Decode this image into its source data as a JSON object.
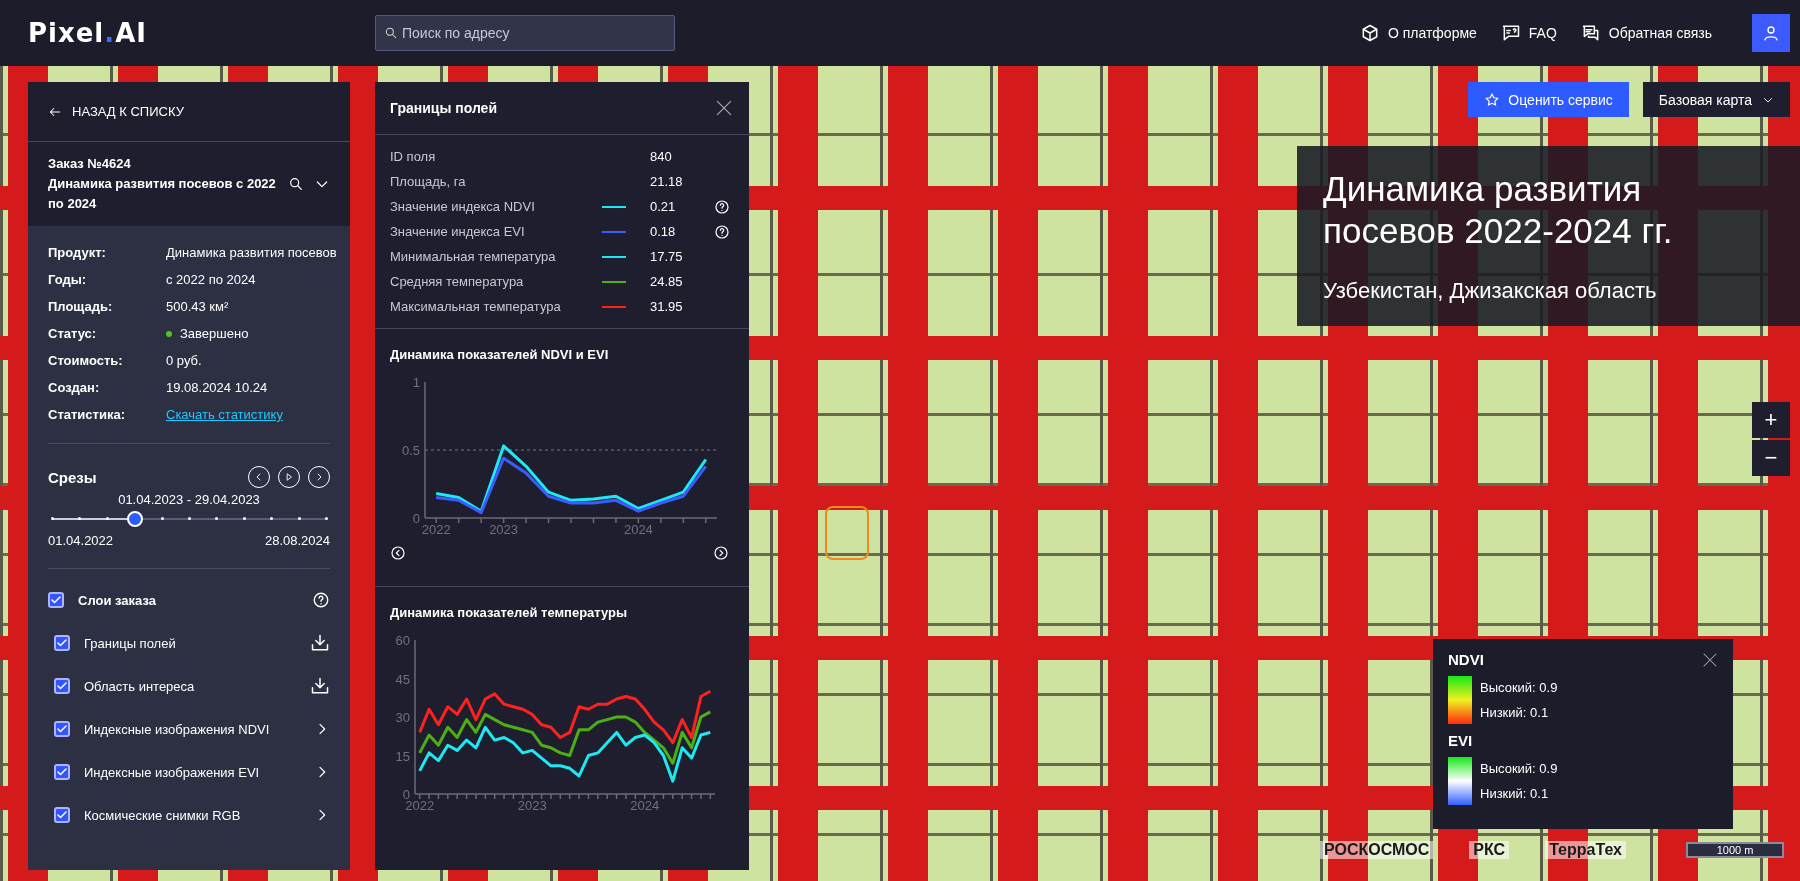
{
  "topbar": {
    "logo": {
      "main": "Pixel",
      "dot": ".",
      "suffix": "AI"
    },
    "search": {
      "placeholder": "Поиск по адресу"
    },
    "nav": [
      {
        "label": "О платформе"
      },
      {
        "label": "FAQ"
      },
      {
        "label": "Обратная связь"
      }
    ]
  },
  "order_panel": {
    "back": "НАЗАД К СПИСКУ",
    "order_number": "Заказ №4624",
    "order_title": "Динамика развития посевов с 2022 по 2024",
    "details": [
      {
        "label": "Продукт:",
        "value": "Динамика развития посевов",
        "kind": "text"
      },
      {
        "label": "Годы:",
        "value": "с 2022 по 2024",
        "kind": "text"
      },
      {
        "label": "Площадь:",
        "value": "500.43 км²",
        "kind": "text"
      },
      {
        "label": "Статус:",
        "value": "Завершено",
        "kind": "status",
        "color": "#52c41a"
      },
      {
        "label": "Стоимость:",
        "value": "0 руб.",
        "kind": "text"
      },
      {
        "label": "Создан:",
        "value": "19.08.2024 10.24",
        "kind": "text"
      },
      {
        "label": "Статистика:",
        "value": "Скачать статистику",
        "kind": "link"
      }
    ],
    "slices": {
      "title": "Срезы",
      "range": "01.04.2023 - 29.04.2023",
      "level": 0.3,
      "start": "01.04.2022",
      "end": "28.08.2024"
    },
    "layers": {
      "title": "Слои заказа",
      "checked": true,
      "items": [
        {
          "label": "Границы полей",
          "checked": true,
          "kind": "download"
        },
        {
          "label": "Область интереса",
          "checked": true,
          "kind": "download"
        },
        {
          "label": "Индексные изображения NDVI",
          "checked": true,
          "kind": "submenu"
        },
        {
          "label": "Индексные изображения EVI",
          "checked": true,
          "kind": "submenu"
        },
        {
          "label": "Космические снимки RGB",
          "checked": true,
          "kind": "submenu"
        }
      ]
    }
  },
  "field_panel": {
    "title": "Границы полей",
    "rows": [
      {
        "label": "ID поля",
        "value": "840",
        "help": false
      },
      {
        "label": "Площадь, га",
        "value": "21.18",
        "help": false
      },
      {
        "label": "Значение индекса NDVI",
        "value": "0.21",
        "color": "#1ee8f2",
        "help": true
      },
      {
        "label": "Значение индекса EVI",
        "value": "0.18",
        "color": "#3b5cff",
        "help": true
      },
      {
        "label": "Минимальная температура",
        "value": "17.75",
        "color": "#1ee8f2",
        "help": false
      },
      {
        "label": "Средняя температура",
        "value": "24.85",
        "color": "#4caf14",
        "help": false
      },
      {
        "label": "Максимальная температура",
        "value": "31.95",
        "color": "#ff2020",
        "help": false
      }
    ],
    "ndvi_chart": {
      "title": "Динамика показателей NDVI и EVI",
      "chart_data": {
        "type": "line",
        "categories": [
          "2022",
          null,
          null,
          "2023",
          null,
          null,
          null,
          null,
          null,
          "2024",
          null,
          null,
          null
        ],
        "ylim": [
          0,
          1
        ],
        "yticks": [
          0,
          0.5,
          1
        ],
        "series": [
          {
            "color": "#1ee8f2",
            "values": [
              0.18,
              0.15,
              0.05,
              0.53,
              0.38,
              0.19,
              0.13,
              0.14,
              0.16,
              0.07,
              0.13,
              0.19,
              0.43
            ]
          },
          {
            "color": "#3b5cff",
            "values": [
              0.15,
              0.13,
              0.04,
              0.44,
              0.33,
              0.16,
              0.11,
              0.11,
              0.13,
              0.05,
              0.11,
              0.16,
              0.38
            ]
          }
        ]
      }
    },
    "temperature_chart": {
      "title": "Динамика показателей температуры",
      "chart_data": {
        "type": "line",
        "categories": [
          "2022",
          null,
          null,
          null,
          null,
          null,
          null,
          null,
          null,
          null,
          null,
          null,
          "2023",
          null,
          null,
          null,
          null,
          null,
          null,
          null,
          null,
          null,
          null,
          null,
          "2024",
          null,
          null,
          null,
          null,
          null,
          null,
          null
        ],
        "ylim": [
          0,
          60
        ],
        "yticks": [
          0,
          15,
          30,
          45,
          60
        ],
        "series": [
          {
            "color": "#ff2020",
            "values": [
              24,
              33,
              27,
              34,
              31,
              37,
              29,
              37,
              39,
              35,
              34,
              33,
              31,
              27,
              26,
              22,
              24,
              34,
              33,
              35,
              35,
              37,
              38,
              37,
              33,
              28,
              25,
              20,
              29,
              22,
              38,
              40
            ]
          },
          {
            "color": "#4caf14",
            "values": [
              16,
              23,
              19,
              26,
              22,
              29,
              24,
              31,
              29,
              27,
              26,
              25,
              24,
              19,
              18,
              16,
              15,
              25,
              25,
              28,
              29,
              30,
              30,
              28,
              24,
              21,
              18,
              12,
              24,
              18,
              30,
              32
            ]
          },
          {
            "color": "#1ee8f2",
            "values": [
              9,
              16,
              13,
              19,
              17,
              21,
              18,
              26,
              21,
              22,
              20,
              16,
              17,
              14,
              11,
              11,
              10,
              7,
              15,
              16,
              20,
              24,
              19,
              22,
              23,
              20,
              15,
              5,
              18,
              14,
              23,
              24
            ]
          }
        ]
      }
    }
  },
  "map": {
    "rate_button": "Оценить сервис",
    "basemap_button": "Базовая карта",
    "title": "Динамика развития посевов 2022-2024 гг.",
    "subtitle": "Узбекистан, Джизакская область",
    "zoom_in": "+",
    "zoom_out": "−",
    "legend": [
      {
        "title": "NDVI",
        "high": "Высокий: 0.9",
        "low": "Низкий: 0.1",
        "kind": "green-yellow-red"
      },
      {
        "title": "EVI",
        "high": "Высокий: 0.9",
        "low": "Низкий: 0.1",
        "kind": "green-white-blue"
      }
    ],
    "scale": "1000 m",
    "logos": [
      "РОСКОСМОС",
      "РКС",
      "ТерраТех"
    ]
  }
}
